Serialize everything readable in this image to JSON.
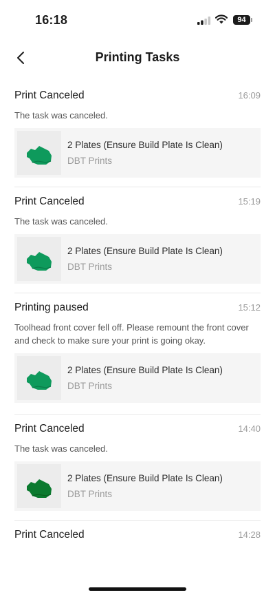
{
  "status": {
    "time": "16:18",
    "battery": "94"
  },
  "nav": {
    "title": "Printing Tasks"
  },
  "tasks": [
    {
      "title": "Print Canceled",
      "time": "16:09",
      "desc": "The task was canceled.",
      "card": {
        "name": "2 Plates (Ensure Build Plate Is Clean)",
        "source": "DBT Prints"
      }
    },
    {
      "title": "Print Canceled",
      "time": "15:19",
      "desc": "The task was canceled.",
      "card": {
        "name": "2 Plates (Ensure Build Plate Is Clean)",
        "source": "DBT Prints"
      }
    },
    {
      "title": "Printing paused",
      "time": "15:12",
      "desc": "Toolhead front cover fell off. Please remount the front cover and check to make sure your print is going okay.",
      "card": {
        "name": "2 Plates (Ensure Build Plate Is Clean)",
        "source": "DBT Prints"
      }
    },
    {
      "title": "Print Canceled",
      "time": "14:40",
      "desc": "The task was canceled.",
      "card": {
        "name": "2 Plates (Ensure Build Plate Is Clean)",
        "source": "DBT Prints"
      }
    },
    {
      "title": "Print Canceled",
      "time": "14:28"
    }
  ],
  "colors": {
    "model_green": "#0e9a5c",
    "model_green_dark": "#0b7a2f"
  },
  "icons": {
    "back": "chevron-left-icon",
    "signal": "cellular-signal-icon",
    "wifi": "wifi-icon",
    "battery": "battery-icon",
    "model": "3d-model-thumbnail"
  }
}
